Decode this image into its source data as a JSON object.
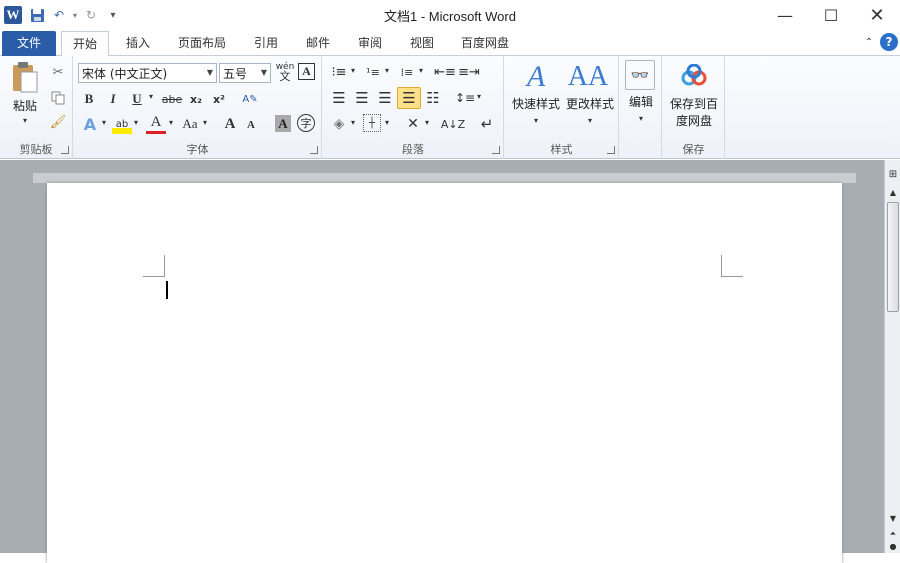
{
  "titlebar": {
    "app_icon": "word-icon",
    "app_icon_letter": "W",
    "title": "文档1  -  Microsoft Word",
    "save_icon": "save-icon",
    "undo_icon": "undo-icon",
    "redo_icon": "redo-icon",
    "customize_icon": "customize-qat-icon"
  },
  "tabs": [
    {
      "label": "文件"
    },
    {
      "label": "开始"
    },
    {
      "label": "插入"
    },
    {
      "label": "页面布局"
    },
    {
      "label": "引用"
    },
    {
      "label": "邮件"
    },
    {
      "label": "审阅"
    },
    {
      "label": "视图"
    },
    {
      "label": "百度网盘"
    }
  ],
  "ribbon": {
    "clipboard": {
      "paste_label": "粘贴",
      "group_label": "剪贴板"
    },
    "font": {
      "font_name": "宋体 (中文正文)",
      "font_size": "五号",
      "group_label": "字体",
      "bold": "B",
      "italic": "I",
      "underline": "U",
      "strike": "abe",
      "sub": "x₂",
      "sup": "x²",
      "grow": "A",
      "shrink": "A",
      "case": "Aa",
      "char_shading": "A",
      "enclose": "字",
      "font_color": "A",
      "effects": "A",
      "wen": "wén",
      "border_a": "A"
    },
    "paragraph": {
      "group_label": "段落"
    },
    "styles": {
      "quick_styles_label": "快速样式",
      "change_styles_label": "更改样式",
      "group_label": "样式"
    },
    "editing": {
      "label": "编辑"
    },
    "save": {
      "label_line1": "保存到百",
      "label_line2": "度网盘",
      "group_label": "保存"
    }
  },
  "colors": {
    "file_tab": "#2a5ca8",
    "ribbon_bg": "#f3f6fb",
    "workarea": "#a8adb4"
  }
}
